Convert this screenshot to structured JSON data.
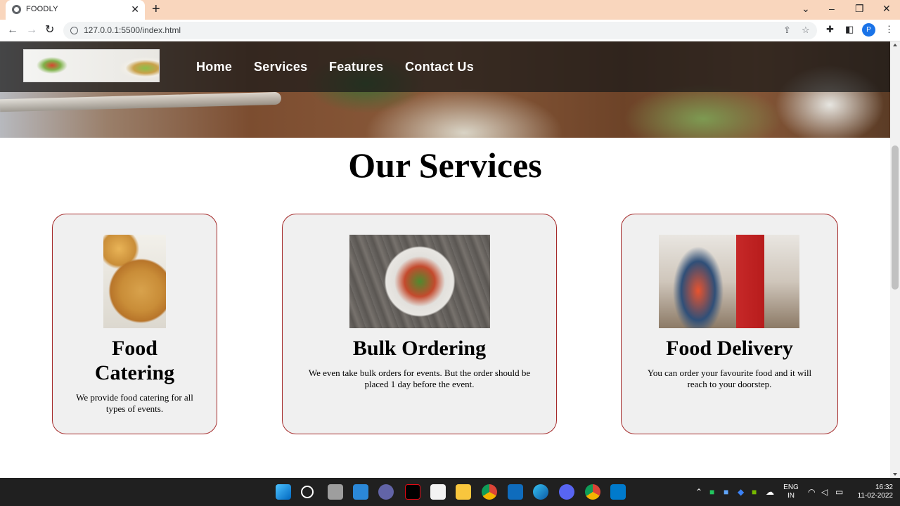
{
  "browser": {
    "tab_title": "FOODLY",
    "url": "127.0.0.1:5500/index.html",
    "profile_initial": "P"
  },
  "site": {
    "nav": [
      "Home",
      "Services",
      "Features",
      "Contact Us"
    ],
    "section_title": "Our Services",
    "cards": [
      {
        "title": "Food Catering",
        "text": "We provide food catering for all types of events."
      },
      {
        "title": "Bulk Ordering",
        "text": "We even take bulk orders for events. But the order should be placed 1 day before the event."
      },
      {
        "title": "Food Delivery",
        "text": "You can order your favourite food and it will reach to your doorstep."
      }
    ],
    "card_border_color": "#a52a2a"
  },
  "taskbar": {
    "lang_line1": "ENG",
    "lang_line2": "IN",
    "time": "16:32",
    "date": "11-02-2022"
  }
}
